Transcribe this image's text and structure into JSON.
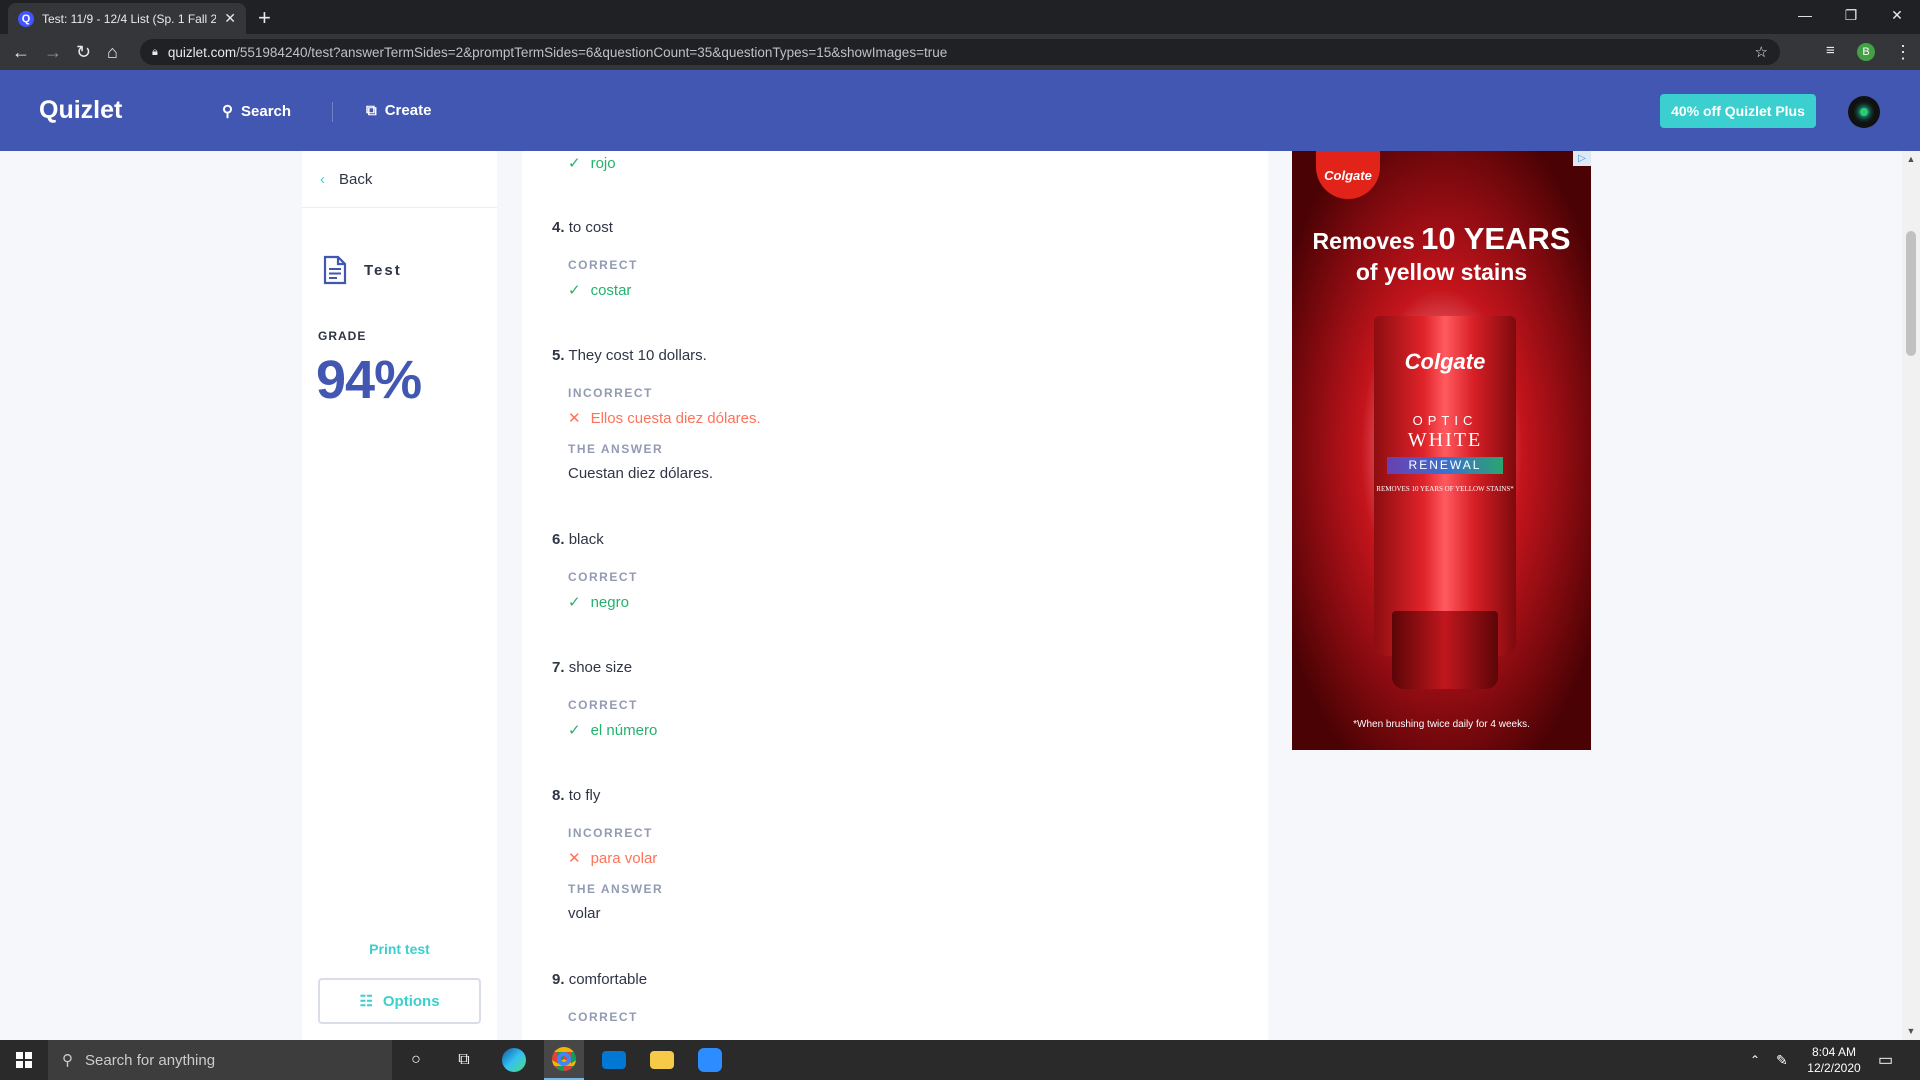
{
  "browser": {
    "tab_title": "Test: 11/9 - 12/4 List (Sp. 1 Fall 2",
    "url_domain": "quizlet.com",
    "url_path": "/551984240/test?answerTermSides=2&promptTermSides=6&questionCount=35&questionTypes=15&showImages=true",
    "profile_initial": "B"
  },
  "header": {
    "logo": "Quizlet",
    "search_label": "Search",
    "create_label": "Create",
    "promo_label": "40% off Quizlet Plus"
  },
  "sidebar": {
    "back_label": "Back",
    "mode_label": "Test",
    "grade_label": "GRADE",
    "grade_value": "94%",
    "print_label": "Print test",
    "options_label": "Options"
  },
  "questions": {
    "q3": {
      "answer": "rojo"
    },
    "q4": {
      "num": "4.",
      "prompt": "to cost",
      "status": "CORRECT",
      "answer": "costar"
    },
    "q5": {
      "num": "5.",
      "prompt": "They cost 10 dollars.",
      "status": "INCORRECT",
      "answer": "Ellos cuesta diez dólares.",
      "answer_label": "THE ANSWER",
      "correct": "Cuestan diez dólares."
    },
    "q6": {
      "num": "6.",
      "prompt": "black",
      "status": "CORRECT",
      "answer": "negro"
    },
    "q7": {
      "num": "7.",
      "prompt": "shoe size",
      "status": "CORRECT",
      "answer": "el número"
    },
    "q8": {
      "num": "8.",
      "prompt": "to fly",
      "status": "INCORRECT",
      "answer": "para volar",
      "answer_label": "THE ANSWER",
      "correct": "volar"
    },
    "q9": {
      "num": "9.",
      "prompt": "comfortable",
      "status": "CORRECT"
    }
  },
  "ad": {
    "brand": "Colgate",
    "headline_pre": "Removes",
    "headline_big": "10 YEARS",
    "headline_line2": "of yellow stains",
    "product_line1": "OPTIC",
    "product_line2": "WHITE",
    "product_line3": "RENEWAL",
    "product_small": "REMOVES 10 YEARS OF YELLOW STAINS*",
    "footnote": "*When brushing twice daily for 4 weeks."
  },
  "taskbar": {
    "search_placeholder": "Search for anything",
    "time": "8:04 AM",
    "date": "12/2/2020"
  },
  "colors": {
    "quizlet_blue": "#4257b2",
    "correct_green": "#23b26d",
    "incorrect_red": "#ff725b",
    "accent_teal": "#3ccfcf"
  }
}
